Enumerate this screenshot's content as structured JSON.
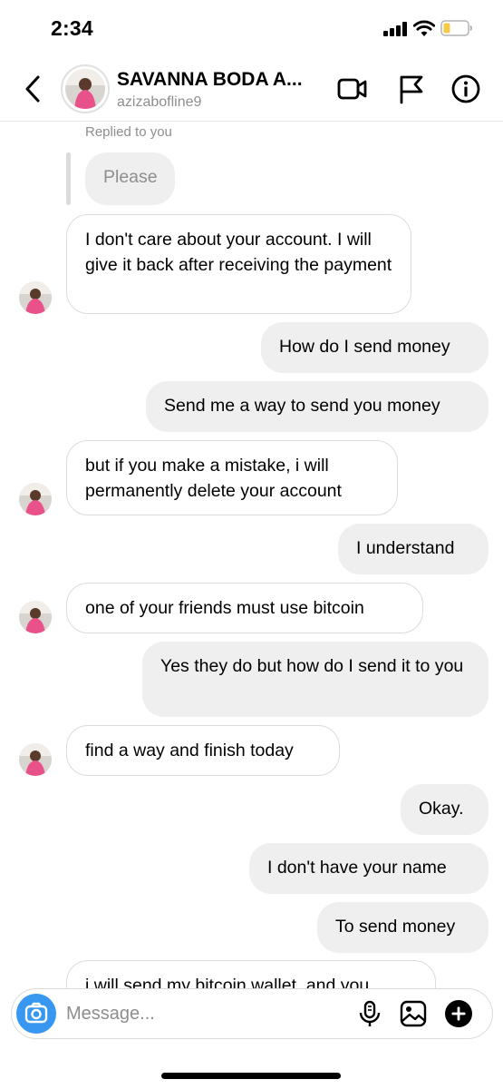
{
  "status_bar": {
    "time": "2:34",
    "battery_color": "#f7c948"
  },
  "header": {
    "display_name": "SAVANNA BODA A...",
    "username": "azizabofline9",
    "icons": [
      "back-icon",
      "video-call-icon",
      "flag-icon",
      "info-icon"
    ]
  },
  "thread": {
    "replied_label": "Replied to you",
    "quoted_message": "Please",
    "messages": [
      {
        "from": "them",
        "text": "I don't care about your account.  I will give it back after receiving the payment"
      },
      {
        "from": "me",
        "text": "How do I send money"
      },
      {
        "from": "me",
        "text": "Send me a way to send you money"
      },
      {
        "from": "them",
        "text": "but if you make a mistake, i will permanently delete your account"
      },
      {
        "from": "me",
        "text": "I understand"
      },
      {
        "from": "them",
        "text": "one of your friends must use bitcoin"
      },
      {
        "from": "me",
        "text": "Yes they do but how do I send it to you"
      },
      {
        "from": "them",
        "text": "find a way and finish today"
      },
      {
        "from": "me",
        "text": "Okay."
      },
      {
        "from": "me",
        "text": "I don't have your name"
      },
      {
        "from": "me",
        "text": "To send money"
      },
      {
        "from": "them",
        "text": "i will send my bitcoin wallet, and you"
      }
    ]
  },
  "composer": {
    "placeholder": "Message...",
    "icons": [
      "camera-icon",
      "microphone-icon",
      "gallery-icon",
      "add-icon"
    ]
  },
  "colors": {
    "accent": "#3897f0",
    "incoming_border": "#dbdbdb",
    "outgoing_bubble": "#efefef",
    "secondary_text": "#8e8e8e"
  }
}
